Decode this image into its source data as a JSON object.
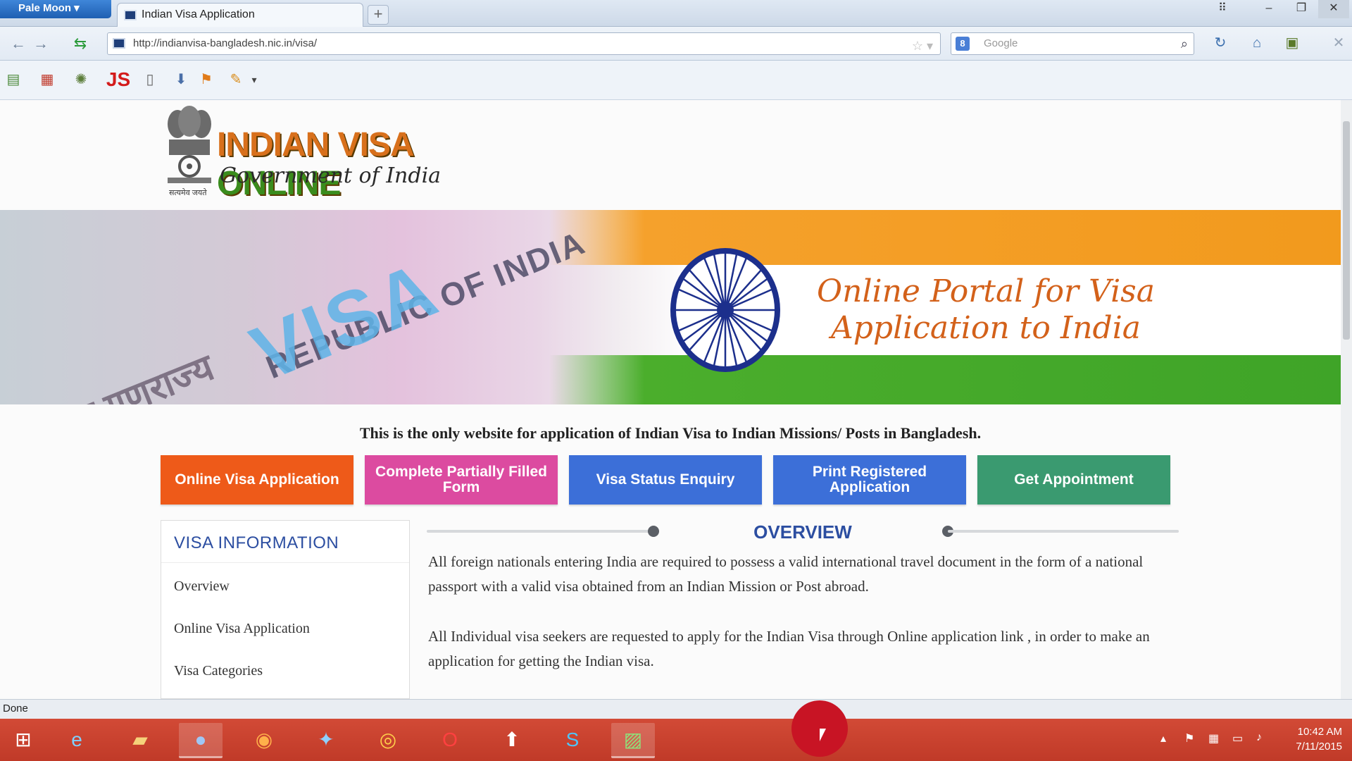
{
  "browser": {
    "app_button": "Pale Moon",
    "tab_title": "Indian Visa Application",
    "new_tab": "+",
    "url": "http://indianvisa-bangladesh.nic.in/visa/",
    "search_placeholder": "Google",
    "search_engine_badge": "8"
  },
  "addons": [
    "page-icon",
    "calendar-icon",
    "bug-icon",
    "JS",
    "cursor-page-icon",
    "download-icon",
    "flag-icon",
    "brush-icon"
  ],
  "site": {
    "logo_title_part1": "INDIAN VISA",
    "logo_title_part2": "ONLINE",
    "logo_subtitle": "Government of India",
    "emblem_caption": "सत्यमेव जयते",
    "banner_text_line1": "Online Portal for Visa",
    "banner_text_line2": "Application to India",
    "banner_visa": "VISA",
    "banner_republic": "REPUBLIC OF INDIA",
    "banner_hindi": "भारत गणराज्य",
    "notice": "This is the only website for application of Indian Visa to Indian Missions/ Posts in Bangladesh."
  },
  "menu_buttons": [
    {
      "label": "Online Visa Application",
      "color": "#ee5a19"
    },
    {
      "label": "Complete Partially Filled Form",
      "color": "#dc4ba0"
    },
    {
      "label": "Visa Status Enquiry",
      "color": "#3c6fd8"
    },
    {
      "label": "Print Registered Application",
      "color": "#3c6fd8"
    },
    {
      "label": "Get Appointment",
      "color": "#3a9a70"
    }
  ],
  "sidebar": {
    "heading": "VISA INFORMATION",
    "items": [
      "Overview",
      "Online Visa Application",
      "Visa Categories"
    ]
  },
  "overview": {
    "title": "OVERVIEW",
    "paragraph1": "All foreign nationals entering India are required to possess a valid international travel document in the form of a national passport with a valid visa obtained from an Indian Mission or Post abroad.",
    "paragraph2": "All Individual visa seekers are requested to apply for the Indian Visa through Online application link , in order to make an application for getting the Indian visa."
  },
  "status_bar": "Done",
  "taskbar": {
    "icons": [
      "windows-start-icon",
      "internet-explorer-icon",
      "file-explorer-icon",
      "pale-moon-icon",
      "firefox-icon",
      "safari-icon",
      "media-player-icon",
      "opera-icon",
      "uploader-icon",
      "skype-icon",
      "image-editor-icon"
    ],
    "time": "10:42 AM",
    "date": "7/11/2015"
  }
}
